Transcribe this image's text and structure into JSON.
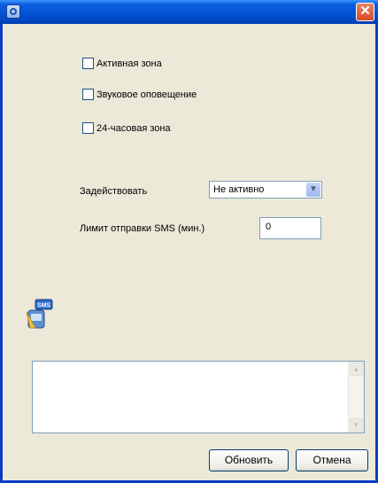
{
  "window": {
    "title": "",
    "close_symbol": "✕"
  },
  "options": [
    {
      "label": "Активная зона",
      "checked": false
    },
    {
      "label": "Звуковое оповещение",
      "checked": false
    },
    {
      "label": "24-часовая зона",
      "checked": false
    }
  ],
  "activate": {
    "label": "Задействовать",
    "selected": "Не активно"
  },
  "sms_limit": {
    "label": "Лимит отправки SMS (мин.)",
    "value": "0"
  },
  "sms_icon": {
    "name": "sms-icon",
    "text": "SMS"
  },
  "message_area": {
    "value": ""
  },
  "buttons": {
    "update": "Обновить",
    "cancel": "Отмена"
  }
}
